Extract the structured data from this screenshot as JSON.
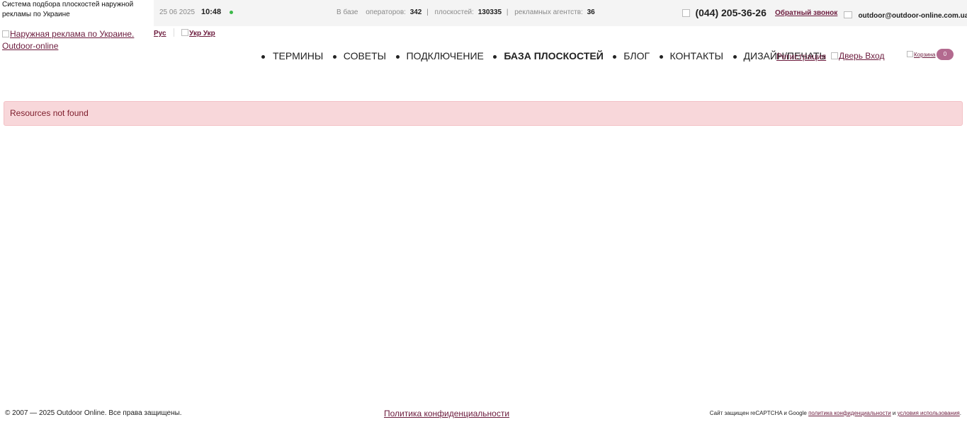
{
  "header": {
    "tagline": "Система подбора плоскостей наружной рекламы по Украине",
    "date": "25 06 2025",
    "time": "10:48",
    "online_color": "#3cb94a",
    "stats": {
      "prefix": "В базе",
      "operators_label": "операторов:",
      "operators_value": "342",
      "surfaces_label": "плоскостей:",
      "surfaces_value": "130335",
      "agencies_label": "рекламных агентств:",
      "agencies_value": "36",
      "separator": "|"
    },
    "phone": "(044) 205-36-26",
    "callback_label": "Обратный звонок",
    "email": "outdoor@outdoor-online.com.ua"
  },
  "logo": {
    "alt_text": "Наружная реклама по Украине. Outdoor-online"
  },
  "lang": {
    "ru_label": "Рус",
    "uk_label": "Укр Укр"
  },
  "nav": {
    "items": [
      {
        "label": "ТЕРМИНЫ"
      },
      {
        "label": "СОВЕТЫ"
      },
      {
        "label": "ПОДКЛЮЧЕНИЕ"
      },
      {
        "label": "БАЗА ПЛОСКОСТЕЙ",
        "active": true
      },
      {
        "label": "БЛОГ"
      },
      {
        "label": "КОНТАКТЫ"
      },
      {
        "label": "ДИЗАЙН/ПЕЧАТЬ"
      }
    ]
  },
  "account": {
    "register_label": "Регистрация",
    "login_label": "Дверь  Вход",
    "cart_label": "Корзина",
    "cart_count": "0"
  },
  "main": {
    "alert_text": "Resources not found"
  },
  "footer": {
    "copyright": "© 2007 — 2025 Outdoor Online. Все права защищены.",
    "privacy_label": "Политика конфиденциальности",
    "recaptcha_prefix": "Сайт защищен reCAPTCHA и Google",
    "recaptcha_privacy": "политика конфиденциальности",
    "recaptcha_and": "и",
    "recaptcha_terms": "условия использования",
    "recaptcha_suffix": "."
  },
  "colors": {
    "link": "#6b1a3c",
    "alert_bg": "#f8d7da",
    "alert_text": "#7d1c2b",
    "topbar_bg": "#f4f4f4",
    "cart_badge": "#b36a8f"
  }
}
